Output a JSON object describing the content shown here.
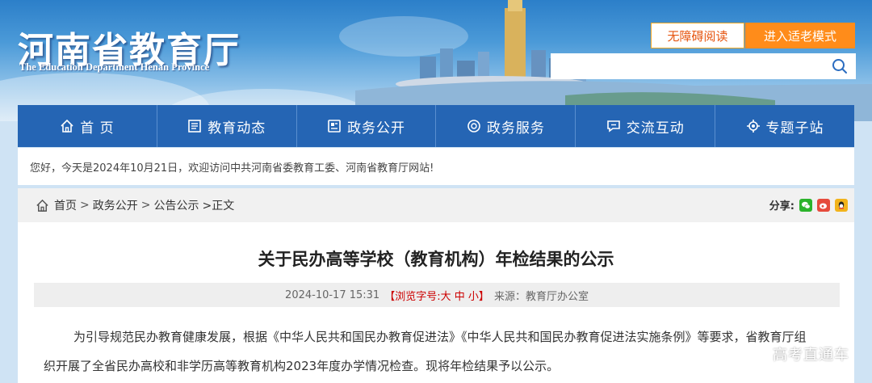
{
  "header": {
    "title": "河南省教育厅",
    "subtitle": "The Education Department Henan Province",
    "accessible_label": "无障碍阅读",
    "elder_mode_label": "进入适老模式",
    "search_placeholder": ""
  },
  "nav": {
    "items": [
      {
        "label": "首 页",
        "icon": "home-icon"
      },
      {
        "label": "教育动态",
        "icon": "news-icon"
      },
      {
        "label": "政务公开",
        "icon": "document-icon"
      },
      {
        "label": "政务服务",
        "icon": "service-icon"
      },
      {
        "label": "交流互动",
        "icon": "chat-icon"
      },
      {
        "label": "专题子站",
        "icon": "gear-icon"
      }
    ]
  },
  "welcome": {
    "text": "您好，今天是2024年10月21日，欢迎访问中共河南省委教育工委、河南省教育厅网站!"
  },
  "breadcrumb": {
    "items": [
      "首页",
      "政务公开",
      "公告公示"
    ],
    "current": ">正文",
    "separator": ">"
  },
  "share": {
    "label": "分享:",
    "icons": [
      "wechat-icon",
      "weibo-icon",
      "qq-icon"
    ]
  },
  "article": {
    "title": "关于民办高等学校（教育机构）年检结果的公示",
    "date": "2024-10-17 15:31",
    "font_size_prefix": "【浏览字号:",
    "font_sizes": [
      "大",
      "中",
      "小"
    ],
    "font_size_suffix": "】",
    "source": "来源：教育厅办公室",
    "paragraph1": "为引导规范民办教育健康发展，根据《中华人民共和国民办教育促进法》《中华人民共和国民办教育促进法实施条例》等要求，省教育厅组",
    "paragraph2": "织开展了全省民办高校和非学历高等教育机构2023年度办学情况检查。现将年检结果予以公示。"
  },
  "watermark": "高考直通车",
  "colors": {
    "nav_bg": "#2565b4",
    "accent_orange": "#ff8c1a",
    "font_size_red": "#cc0000"
  }
}
